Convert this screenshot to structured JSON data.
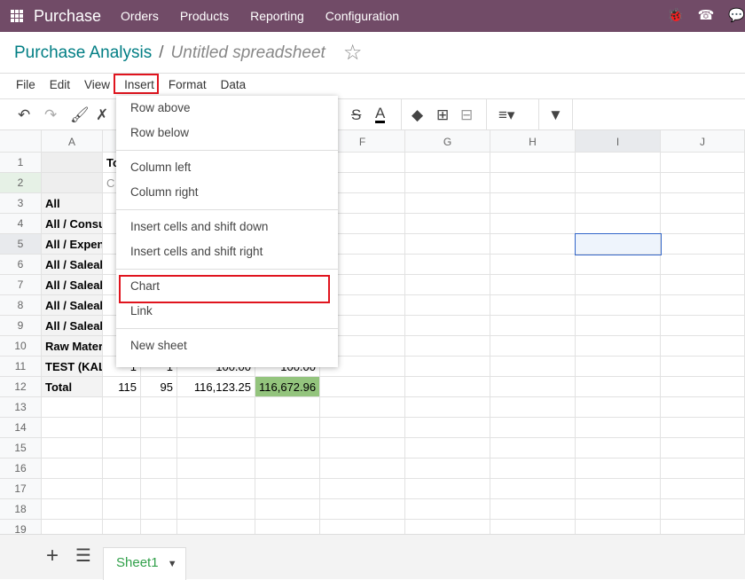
{
  "topbar": {
    "brand": "Purchase",
    "nav": [
      "Orders",
      "Products",
      "Reporting",
      "Configuration"
    ]
  },
  "breadcrumb": {
    "parent": "Purchase Analysis",
    "separator": "/",
    "current": "Untitled spreadsheet"
  },
  "menubar": [
    "File",
    "Edit",
    "View",
    "Insert",
    "Format",
    "Data"
  ],
  "insert_menu": {
    "groups": [
      [
        "Row above",
        "Row below"
      ],
      [
        "Column left",
        "Column right"
      ],
      [
        "Insert cells and shift down",
        "Insert cells and shift right"
      ],
      [
        "Chart",
        "Link"
      ],
      [
        "New sheet"
      ]
    ]
  },
  "columns": [
    "A",
    "B",
    "C",
    "D",
    "E",
    "F",
    "G",
    "H",
    "I",
    "J"
  ],
  "rows": [
    {
      "n": "1",
      "cells": [
        "",
        "To",
        "",
        "",
        "",
        "",
        "",
        "",
        "",
        ""
      ]
    },
    {
      "n": "2",
      "cells": [
        "",
        "C",
        "",
        "",
        "",
        "",
        "",
        "",
        "",
        ""
      ]
    },
    {
      "n": "3",
      "cells": [
        "All",
        "",
        "",
        "",
        "",
        "",
        "",
        "",
        "",
        ""
      ]
    },
    {
      "n": "4",
      "cells": [
        "All / Consu",
        "",
        "",
        "",
        "",
        "",
        "",
        "",
        "",
        ""
      ]
    },
    {
      "n": "5",
      "cells": [
        "All / Expen",
        "",
        "",
        "",
        "",
        "",
        "",
        "",
        "",
        ""
      ]
    },
    {
      "n": "6",
      "cells": [
        "All / Saleab",
        "",
        "",
        "",
        "",
        "",
        "",
        "",
        "",
        ""
      ]
    },
    {
      "n": "7",
      "cells": [
        "All / Saleab",
        "",
        "",
        "",
        "",
        "",
        "",
        "",
        "",
        ""
      ]
    },
    {
      "n": "8",
      "cells": [
        "All / Saleab",
        "",
        "",
        "",
        "",
        "",
        "",
        "",
        "",
        ""
      ]
    },
    {
      "n": "9",
      "cells": [
        "All / Saleab",
        "",
        "",
        "",
        "",
        "",
        "",
        "",
        "",
        ""
      ]
    },
    {
      "n": "10",
      "cells": [
        "Raw Mater",
        "",
        "",
        "",
        "",
        "",
        "",
        "",
        "",
        ""
      ]
    },
    {
      "n": "11",
      "cells": [
        "TEST (KAL",
        "1",
        "1",
        "100.00",
        "100.00",
        "",
        "",
        "",
        "",
        ""
      ]
    },
    {
      "n": "12",
      "cells": [
        "Total",
        "115",
        "95",
        "116,123.25",
        "116,672.96",
        "",
        "",
        "",
        "",
        ""
      ]
    },
    {
      "n": "13",
      "cells": [
        "",
        "",
        "",
        "",
        "",
        "",
        "",
        "",
        "",
        ""
      ]
    },
    {
      "n": "14",
      "cells": [
        "",
        "",
        "",
        "",
        "",
        "",
        "",
        "",
        "",
        ""
      ]
    },
    {
      "n": "15",
      "cells": [
        "",
        "",
        "",
        "",
        "",
        "",
        "",
        "",
        "",
        ""
      ]
    },
    {
      "n": "16",
      "cells": [
        "",
        "",
        "",
        "",
        "",
        "",
        "",
        "",
        "",
        ""
      ]
    },
    {
      "n": "17",
      "cells": [
        "",
        "",
        "",
        "",
        "",
        "",
        "",
        "",
        "",
        ""
      ]
    },
    {
      "n": "18",
      "cells": [
        "",
        "",
        "",
        "",
        "",
        "",
        "",
        "",
        "",
        ""
      ]
    },
    {
      "n": "19",
      "cells": [
        "",
        "",
        "",
        "",
        "",
        "",
        "",
        "",
        "",
        ""
      ]
    }
  ],
  "sheet_tab": "Sheet1",
  "colors": {
    "topbar": "#714b67",
    "highlight": "#e0141e",
    "total_fill": "#93c47d"
  }
}
